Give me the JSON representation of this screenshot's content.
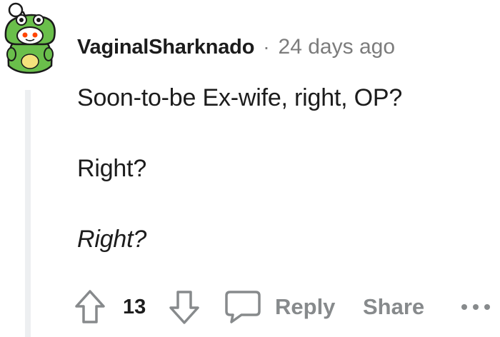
{
  "comment": {
    "username": "VaginalSharknado",
    "separator": "·",
    "timestamp": "24 days ago",
    "body_lines": [
      "Soon-to-be Ex-wife, right, OP?",
      "Right?",
      "Right?"
    ],
    "score": "13"
  },
  "actions": {
    "reply_label": "Reply",
    "share_label": "Share"
  },
  "icons": {
    "avatar": "snoo-frog-avatar",
    "upvote": "arrow-up-icon",
    "downvote": "arrow-down-icon",
    "comment": "speech-bubble-icon",
    "more": "ellipsis-icon"
  },
  "colors": {
    "text_primary": "#1c1c1c",
    "text_secondary": "#7c7c7c",
    "action_gray": "#878a8c",
    "thread_line": "#edeff1",
    "avatar_green": "#6abf4b",
    "avatar_red": "#ff4500"
  }
}
